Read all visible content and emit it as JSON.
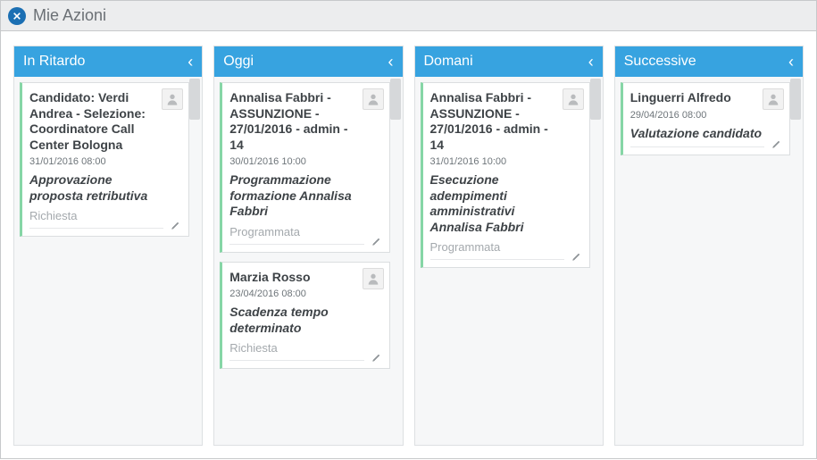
{
  "window": {
    "title": "Mie Azioni"
  },
  "columns": [
    {
      "title": "In Ritardo",
      "cards": [
        {
          "title": "Candidato: Verdi Andrea - Selezione: Coordinatore Call Center Bologna",
          "date": "31/01/2016 08:00",
          "desc": "Approvazione proposta retributiva",
          "status": "Richiesta"
        }
      ]
    },
    {
      "title": "Oggi",
      "cards": [
        {
          "title": "Annalisa Fabbri - ASSUNZIONE - 27/01/2016 - admin - 14",
          "date": "30/01/2016 10:00",
          "desc": "Programmazione formazione Annalisa Fabbri",
          "status": "Programmata"
        },
        {
          "title": "Marzia Rosso",
          "date": "23/04/2016 08:00",
          "desc": "Scadenza tempo determinato",
          "status": "Richiesta"
        }
      ]
    },
    {
      "title": "Domani",
      "cards": [
        {
          "title": "Annalisa Fabbri - ASSUNZIONE - 27/01/2016 - admin - 14",
          "date": "31/01/2016 10:00",
          "desc": "Esecuzione adempimenti amministrativi Annalisa Fabbri",
          "status": "Programmata"
        }
      ]
    },
    {
      "title": "Successive",
      "cards": [
        {
          "title": "Linguerri Alfredo",
          "date": "29/04/2016 08:00",
          "desc": "Valutazione candidato",
          "status": ""
        }
      ]
    }
  ]
}
